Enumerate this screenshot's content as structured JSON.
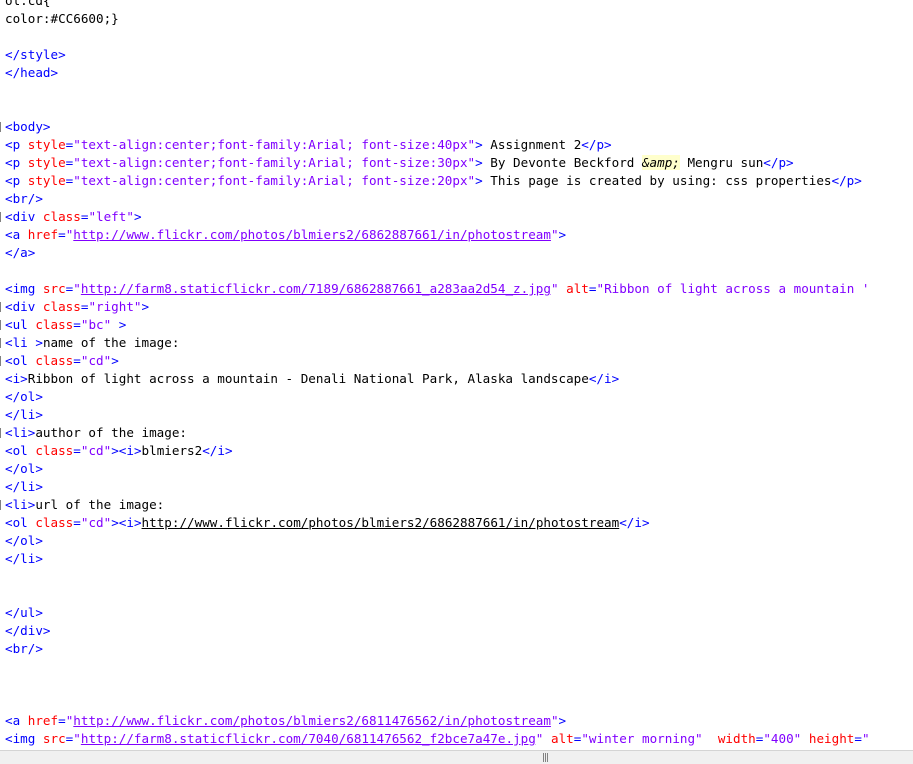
{
  "lines": [
    {
      "segments": [
        {
          "t": "ol.cd{",
          "c": "txt"
        }
      ]
    },
    {
      "segments": [
        {
          "t": "color:#CC6600;}",
          "c": "txt"
        }
      ]
    },
    {
      "segments": []
    },
    {
      "segments": [
        {
          "t": "</style>",
          "c": "tag"
        }
      ]
    },
    {
      "segments": [
        {
          "t": "</head>",
          "c": "tag"
        }
      ]
    },
    {
      "segments": []
    },
    {
      "segments": []
    },
    {
      "fold": true,
      "segments": [
        {
          "t": "<body>",
          "c": "tag"
        }
      ]
    },
    {
      "segments": [
        {
          "t": "<p ",
          "c": "tag"
        },
        {
          "t": "style",
          "c": "attr"
        },
        {
          "t": "=",
          "c": "tag"
        },
        {
          "t": "\"text-align:center;font-family:Arial; font-size:40px\"",
          "c": "val"
        },
        {
          "t": ">",
          "c": "tag"
        },
        {
          "t": " Assignment 2",
          "c": "txt"
        },
        {
          "t": "</p>",
          "c": "tag"
        }
      ]
    },
    {
      "segments": [
        {
          "t": "<p ",
          "c": "tag"
        },
        {
          "t": "style",
          "c": "attr"
        },
        {
          "t": "=",
          "c": "tag"
        },
        {
          "t": "\"text-align:center;font-family:Arial; font-size:30px\"",
          "c": "val"
        },
        {
          "t": ">",
          "c": "tag"
        },
        {
          "t": " By Devonte Beckford ",
          "c": "txt"
        },
        {
          "t": "&amp;",
          "c": "ent"
        },
        {
          "t": " Mengru sun",
          "c": "txt"
        },
        {
          "t": "</p>",
          "c": "tag"
        }
      ]
    },
    {
      "segments": [
        {
          "t": "<p ",
          "c": "tag"
        },
        {
          "t": "style",
          "c": "attr"
        },
        {
          "t": "=",
          "c": "tag"
        },
        {
          "t": "\"text-align:center;font-family:Arial; font-size:20px\"",
          "c": "val"
        },
        {
          "t": ">",
          "c": "tag"
        },
        {
          "t": " This page is created by using: css properties",
          "c": "txt"
        },
        {
          "t": "</p>",
          "c": "tag"
        }
      ]
    },
    {
      "segments": [
        {
          "t": "<br/>",
          "c": "tag"
        }
      ]
    },
    {
      "fold": true,
      "segments": [
        {
          "t": "<div ",
          "c": "tag"
        },
        {
          "t": "class",
          "c": "attr"
        },
        {
          "t": "=",
          "c": "tag"
        },
        {
          "t": "\"left\"",
          "c": "val"
        },
        {
          "t": ">",
          "c": "tag"
        }
      ]
    },
    {
      "segments": [
        {
          "t": "<a ",
          "c": "tag"
        },
        {
          "t": "href",
          "c": "attr"
        },
        {
          "t": "=",
          "c": "tag"
        },
        {
          "t": "\"",
          "c": "val"
        },
        {
          "t": "http://www.flickr.com/photos/blmiers2/6862887661/in/photostream",
          "c": "url"
        },
        {
          "t": "\"",
          "c": "val"
        },
        {
          "t": ">",
          "c": "tag"
        }
      ]
    },
    {
      "segments": [
        {
          "t": "</a>",
          "c": "tag"
        }
      ]
    },
    {
      "segments": []
    },
    {
      "segments": [
        {
          "t": "<img ",
          "c": "tag"
        },
        {
          "t": "src",
          "c": "attr"
        },
        {
          "t": "=",
          "c": "tag"
        },
        {
          "t": "\"",
          "c": "val"
        },
        {
          "t": "http://farm8.staticflickr.com/7189/6862887661_a283aa2d54_z.jpg",
          "c": "url"
        },
        {
          "t": "\"",
          "c": "val"
        },
        {
          "t": " ",
          "c": "tag"
        },
        {
          "t": "alt",
          "c": "attr"
        },
        {
          "t": "=",
          "c": "tag"
        },
        {
          "t": "\"Ribbon of light across a mountain '",
          "c": "val"
        }
      ]
    },
    {
      "fold": true,
      "segments": [
        {
          "t": "<div ",
          "c": "tag"
        },
        {
          "t": "class",
          "c": "attr"
        },
        {
          "t": "=",
          "c": "tag"
        },
        {
          "t": "\"right\"",
          "c": "val"
        },
        {
          "t": ">",
          "c": "tag"
        }
      ]
    },
    {
      "fold": true,
      "segments": [
        {
          "t": "<ul ",
          "c": "tag"
        },
        {
          "t": "class",
          "c": "attr"
        },
        {
          "t": "=",
          "c": "tag"
        },
        {
          "t": "\"bc\"",
          "c": "val"
        },
        {
          "t": " >",
          "c": "tag"
        }
      ]
    },
    {
      "fold": true,
      "segments": [
        {
          "t": "<li ",
          "c": "tag"
        },
        {
          "t": ">",
          "c": "tag"
        },
        {
          "t": "name of the image:",
          "c": "txt"
        }
      ]
    },
    {
      "fold": true,
      "segments": [
        {
          "t": "<ol ",
          "c": "tag"
        },
        {
          "t": "class",
          "c": "attr"
        },
        {
          "t": "=",
          "c": "tag"
        },
        {
          "t": "\"cd\"",
          "c": "val"
        },
        {
          "t": ">",
          "c": "tag"
        }
      ]
    },
    {
      "segments": [
        {
          "t": "<i>",
          "c": "tag"
        },
        {
          "t": "Ribbon of light across a mountain - Denali National Park, Alaska landscape",
          "c": "txt"
        },
        {
          "t": "</i>",
          "c": "tag"
        }
      ]
    },
    {
      "segments": [
        {
          "t": "</ol>",
          "c": "tag"
        }
      ]
    },
    {
      "segments": [
        {
          "t": "</li>",
          "c": "tag"
        }
      ]
    },
    {
      "fold": true,
      "segments": [
        {
          "t": "<li>",
          "c": "tag"
        },
        {
          "t": "author of the image:",
          "c": "txt"
        }
      ]
    },
    {
      "segments": [
        {
          "t": "<ol ",
          "c": "tag"
        },
        {
          "t": "class",
          "c": "attr"
        },
        {
          "t": "=",
          "c": "tag"
        },
        {
          "t": "\"cd\"",
          "c": "val"
        },
        {
          "t": "><i>",
          "c": "tag"
        },
        {
          "t": "blmiers2",
          "c": "txt"
        },
        {
          "t": "</i>",
          "c": "tag"
        }
      ]
    },
    {
      "segments": [
        {
          "t": "</ol>",
          "c": "tag"
        }
      ]
    },
    {
      "segments": [
        {
          "t": "</li>",
          "c": "tag"
        }
      ]
    },
    {
      "fold": true,
      "segments": [
        {
          "t": "<li>",
          "c": "tag"
        },
        {
          "t": "url of the image:",
          "c": "txt"
        }
      ]
    },
    {
      "segments": [
        {
          "t": "<ol ",
          "c": "tag"
        },
        {
          "t": "class",
          "c": "attr"
        },
        {
          "t": "=",
          "c": "tag"
        },
        {
          "t": "\"cd\"",
          "c": "val"
        },
        {
          "t": "><i>",
          "c": "tag"
        },
        {
          "t": "http://www.flickr.com/photos/blmiers2/6862887661/in/photostream",
          "c": "urlb"
        },
        {
          "t": "</i>",
          "c": "tag"
        }
      ]
    },
    {
      "segments": [
        {
          "t": "</ol>",
          "c": "tag"
        }
      ]
    },
    {
      "segments": [
        {
          "t": "</li>",
          "c": "tag"
        }
      ]
    },
    {
      "segments": []
    },
    {
      "segments": []
    },
    {
      "segments": [
        {
          "t": "</ul>",
          "c": "tag"
        }
      ]
    },
    {
      "segments": [
        {
          "t": "</div>",
          "c": "tag"
        }
      ]
    },
    {
      "segments": [
        {
          "t": "<br/>",
          "c": "tag"
        }
      ]
    },
    {
      "segments": []
    },
    {
      "segments": []
    },
    {
      "segments": []
    },
    {
      "segments": [
        {
          "t": "<a ",
          "c": "tag"
        },
        {
          "t": "href",
          "c": "attr"
        },
        {
          "t": "=",
          "c": "tag"
        },
        {
          "t": "\"",
          "c": "val"
        },
        {
          "t": "http://www.flickr.com/photos/blmiers2/6811476562/in/photostream",
          "c": "url"
        },
        {
          "t": "\"",
          "c": "val"
        },
        {
          "t": ">",
          "c": "tag"
        }
      ]
    },
    {
      "segments": [
        {
          "t": "<img ",
          "c": "tag"
        },
        {
          "t": "src",
          "c": "attr"
        },
        {
          "t": "=",
          "c": "tag"
        },
        {
          "t": "\"",
          "c": "val"
        },
        {
          "t": "http://farm8.staticflickr.com/7040/6811476562_f2bce7a47e.jpg",
          "c": "url"
        },
        {
          "t": "\"",
          "c": "val"
        },
        {
          "t": " ",
          "c": "tag"
        },
        {
          "t": "alt",
          "c": "attr"
        },
        {
          "t": "=",
          "c": "tag"
        },
        {
          "t": "\"winter morning\"",
          "c": "val"
        },
        {
          "t": "  ",
          "c": "tag"
        },
        {
          "t": "width",
          "c": "attr"
        },
        {
          "t": "=",
          "c": "tag"
        },
        {
          "t": "\"400\"",
          "c": "val"
        },
        {
          "t": " ",
          "c": "tag"
        },
        {
          "t": "height",
          "c": "attr"
        },
        {
          "t": "=",
          "c": "tag"
        },
        {
          "t": "\"",
          "c": "val"
        }
      ]
    }
  ],
  "scrollbar": {
    "grip": "|||"
  }
}
